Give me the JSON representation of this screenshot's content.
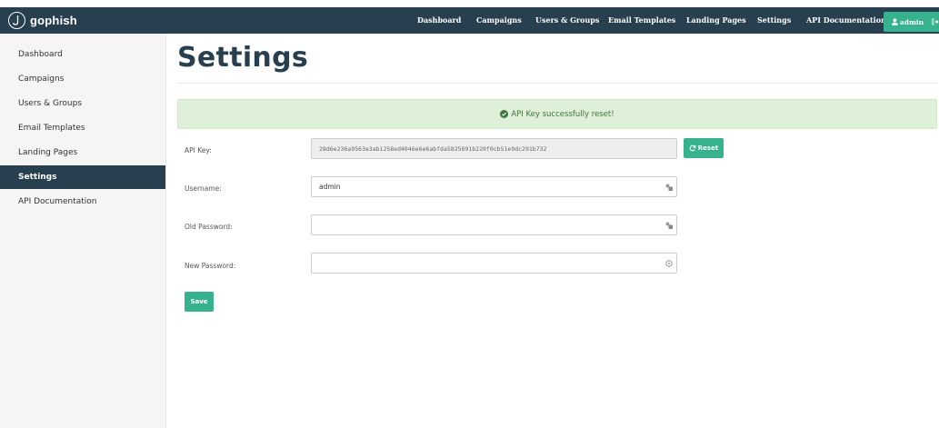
{
  "brand": {
    "name": "gophish"
  },
  "nav": {
    "links": [
      "Dashboard",
      "Campaigns",
      "Users & Groups",
      "Email Templates",
      "Landing Pages",
      "Settings",
      "API Documentation"
    ],
    "user": "admin"
  },
  "sidebar": {
    "items": [
      {
        "label": "Dashboard"
      },
      {
        "label": "Campaigns"
      },
      {
        "label": "Users & Groups"
      },
      {
        "label": "Email Templates"
      },
      {
        "label": "Landing Pages"
      },
      {
        "label": "Settings",
        "active": true
      },
      {
        "label": "API Documentation"
      }
    ]
  },
  "page": {
    "title": "Settings"
  },
  "alert": {
    "message": "API Key successfully reset!"
  },
  "form": {
    "api_key": {
      "label": "API Key:",
      "value": "28d6e236a9563e3ab1258ed4046e6e6abfda5825891b220f0cb51e9dc291b732"
    },
    "reset_button": "Reset",
    "username": {
      "label": "Username:",
      "value": "admin"
    },
    "old_password": {
      "label": "Old Password:",
      "value": ""
    },
    "new_password": {
      "label": "New Password:",
      "value": ""
    },
    "save_button": "Save"
  },
  "colors": {
    "navbar": "#283f50",
    "accent": "#37b28e",
    "alert_bg": "#dff0d8",
    "alert_text": "#3c763d"
  },
  "icons": [
    "gophish-logo-icon",
    "user-icon",
    "logout-icon",
    "check-circle-icon",
    "refresh-icon",
    "password-manager-icon",
    "key-icon"
  ]
}
